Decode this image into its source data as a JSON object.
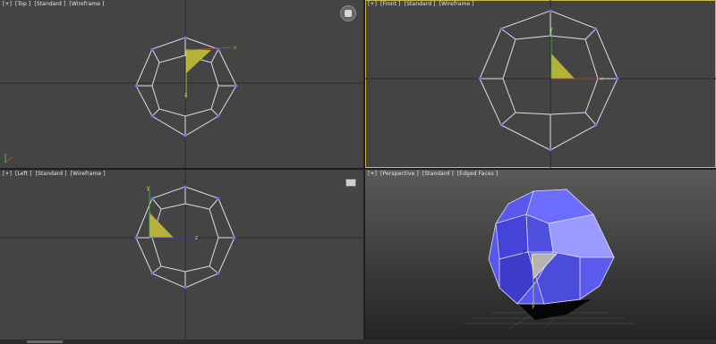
{
  "viewports": {
    "top": {
      "bracket": "[+]",
      "view": "[Top ]",
      "shading": "[Standard ]",
      "mode": "[Wireframe ]"
    },
    "front": {
      "bracket": "[+]",
      "view": "[Front ]",
      "shading": "[Standard ]",
      "mode": "[Wireframe ]"
    },
    "left": {
      "bracket": "[+]",
      "view": "[Left ]",
      "shading": "[Standard ]",
      "mode": "[Wireframe ]"
    },
    "persp": {
      "bracket": "[+]",
      "view": "[Perspective ]",
      "shading": "[Standard ]",
      "mode": "[Edged Faces ]"
    }
  },
  "colors": {
    "viewport_bg": "#444444",
    "wire": "#dcdcf0",
    "vertex": "#6a6aff",
    "selected_face": "#b5b23a",
    "active_border": "#c8b94a",
    "mesh_face": "#5a5af0"
  },
  "icons": [
    "viewcube-icon",
    "maximize-icon",
    "axis-gizmo-icon"
  ]
}
